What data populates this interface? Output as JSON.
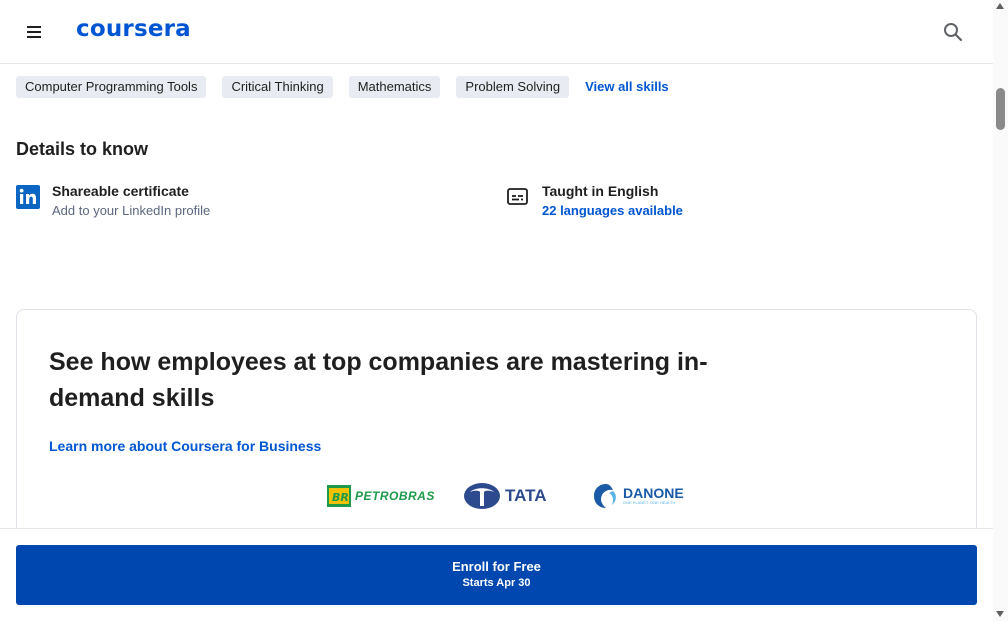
{
  "header": {
    "logo_text": "coursera",
    "menu_icon": "hamburger-menu-icon",
    "search_icon": "search-icon"
  },
  "skills": {
    "chips": [
      "Computer Programming Tools",
      "Critical Thinking",
      "Mathematics",
      "Problem Solving"
    ],
    "view_all_label": "View all skills"
  },
  "details": {
    "title": "Details to know",
    "certificate": {
      "icon": "linkedin-icon",
      "title": "Shareable certificate",
      "subtitle": "Add to your LinkedIn profile"
    },
    "language": {
      "icon": "closed-captions-icon",
      "title": "Taught in English",
      "link": "22 languages available"
    }
  },
  "business_card": {
    "title": "See how employees at top companies are mastering in-demand skills",
    "link": "Learn more about Coursera for Business",
    "logos": [
      "PETROBRAS",
      "TATA",
      "DANONE"
    ],
    "danone_tagline": "ONE PLANET. ONE HEALTH"
  },
  "enroll": {
    "label": "Enroll for Free",
    "sublabel": "Starts Apr 30"
  },
  "colors": {
    "brand_blue": "#0056d2",
    "button_blue": "#0048b0",
    "chip_bg": "#e8ecf2"
  }
}
